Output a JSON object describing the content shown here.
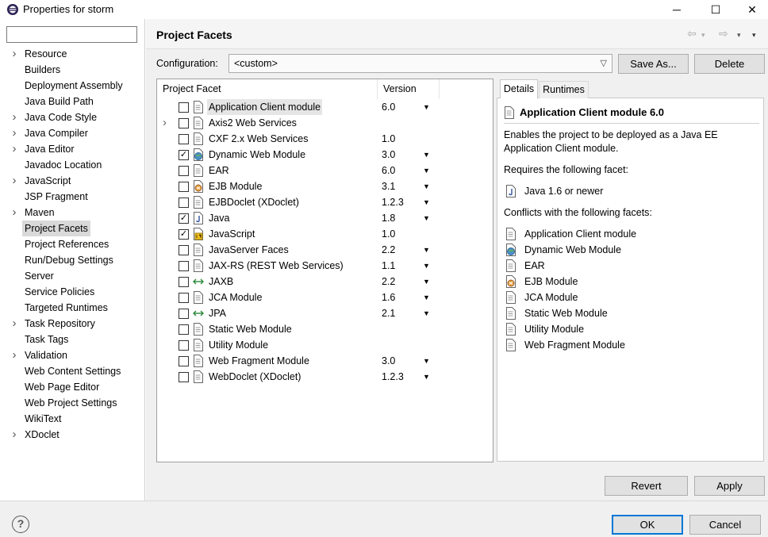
{
  "window": {
    "title": "Properties for storm",
    "minimize": "─",
    "maximize": "☐",
    "close": "✕"
  },
  "sidebar": {
    "filter_value": "",
    "items": [
      {
        "label": "Resource",
        "expandable": true
      },
      {
        "label": "Builders",
        "expandable": false
      },
      {
        "label": "Deployment Assembly",
        "expandable": false
      },
      {
        "label": "Java Build Path",
        "expandable": false
      },
      {
        "label": "Java Code Style",
        "expandable": true
      },
      {
        "label": "Java Compiler",
        "expandable": true
      },
      {
        "label": "Java Editor",
        "expandable": true
      },
      {
        "label": "Javadoc Location",
        "expandable": false
      },
      {
        "label": "JavaScript",
        "expandable": true
      },
      {
        "label": "JSP Fragment",
        "expandable": false
      },
      {
        "label": "Maven",
        "expandable": true
      },
      {
        "label": "Project Facets",
        "expandable": false,
        "selected": true
      },
      {
        "label": "Project References",
        "expandable": false
      },
      {
        "label": "Run/Debug Settings",
        "expandable": false
      },
      {
        "label": "Server",
        "expandable": false
      },
      {
        "label": "Service Policies",
        "expandable": false
      },
      {
        "label": "Targeted Runtimes",
        "expandable": false
      },
      {
        "label": "Task Repository",
        "expandable": true
      },
      {
        "label": "Task Tags",
        "expandable": false
      },
      {
        "label": "Validation",
        "expandable": true
      },
      {
        "label": "Web Content Settings",
        "expandable": false
      },
      {
        "label": "Web Page Editor",
        "expandable": false
      },
      {
        "label": "Web Project Settings",
        "expandable": false
      },
      {
        "label": "WikiText",
        "expandable": false
      },
      {
        "label": "XDoclet",
        "expandable": true
      }
    ]
  },
  "page": {
    "title": "Project Facets",
    "config_label": "Configuration:",
    "config_value": "<custom>",
    "save_as": "Save As...",
    "delete": "Delete",
    "revert": "Revert",
    "apply": "Apply"
  },
  "facets": {
    "col_facet": "Project Facet",
    "col_version": "Version",
    "rows": [
      {
        "name": "Application Client module",
        "version": "6.0",
        "checked": false,
        "dropdown": true,
        "icon": "doc",
        "highlight": true
      },
      {
        "name": "Axis2 Web Services",
        "version": "",
        "checked": false,
        "dropdown": false,
        "icon": "doc",
        "expandable": true
      },
      {
        "name": "CXF 2.x Web Services",
        "version": "1.0",
        "checked": false,
        "dropdown": false,
        "icon": "doc"
      },
      {
        "name": "Dynamic Web Module",
        "version": "3.0",
        "checked": true,
        "dropdown": true,
        "icon": "web"
      },
      {
        "name": "EAR",
        "version": "6.0",
        "checked": false,
        "dropdown": true,
        "icon": "doc"
      },
      {
        "name": "EJB Module",
        "version": "3.1",
        "checked": false,
        "dropdown": true,
        "icon": "ejb"
      },
      {
        "name": "EJBDoclet (XDoclet)",
        "version": "1.2.3",
        "checked": false,
        "dropdown": true,
        "icon": "doc"
      },
      {
        "name": "Java",
        "version": "1.8",
        "checked": true,
        "dropdown": true,
        "icon": "java"
      },
      {
        "name": "JavaScript",
        "version": "1.0",
        "checked": true,
        "dropdown": false,
        "icon": "js"
      },
      {
        "name": "JavaServer Faces",
        "version": "2.2",
        "checked": false,
        "dropdown": true,
        "icon": "doc"
      },
      {
        "name": "JAX-RS (REST Web Services)",
        "version": "1.1",
        "checked": false,
        "dropdown": true,
        "icon": "doc"
      },
      {
        "name": "JAXB",
        "version": "2.2",
        "checked": false,
        "dropdown": true,
        "icon": "arrows"
      },
      {
        "name": "JCA Module",
        "version": "1.6",
        "checked": false,
        "dropdown": true,
        "icon": "doc"
      },
      {
        "name": "JPA",
        "version": "2.1",
        "checked": false,
        "dropdown": true,
        "icon": "arrows"
      },
      {
        "name": "Static Web Module",
        "version": "",
        "checked": false,
        "dropdown": false,
        "icon": "doc"
      },
      {
        "name": "Utility Module",
        "version": "",
        "checked": false,
        "dropdown": false,
        "icon": "doc"
      },
      {
        "name": "Web Fragment Module",
        "version": "3.0",
        "checked": false,
        "dropdown": true,
        "icon": "doc"
      },
      {
        "name": "WebDoclet (XDoclet)",
        "version": "1.2.3",
        "checked": false,
        "dropdown": true,
        "icon": "doc"
      }
    ]
  },
  "details": {
    "tab_details": "Details",
    "tab_runtimes": "Runtimes",
    "title": "Application Client module 6.0",
    "description_1": "Enables the project to be deployed as a Java EE",
    "description_2": "Application Client module.",
    "requires_label": "Requires the following facet:",
    "requires": [
      {
        "name": "Java 1.6 or newer",
        "icon": "java"
      }
    ],
    "conflicts_label": "Conflicts with the following facets:",
    "conflicts": [
      {
        "name": "Application Client module",
        "icon": "doc"
      },
      {
        "name": "Dynamic Web Module",
        "icon": "web"
      },
      {
        "name": "EAR",
        "icon": "doc"
      },
      {
        "name": "EJB Module",
        "icon": "ejb"
      },
      {
        "name": "JCA Module",
        "icon": "doc"
      },
      {
        "name": "Static Web Module",
        "icon": "doc"
      },
      {
        "name": "Utility Module",
        "icon": "doc"
      },
      {
        "name": "Web Fragment Module",
        "icon": "doc"
      }
    ]
  },
  "footer": {
    "help": "?",
    "ok": "OK",
    "cancel": "Cancel"
  },
  "colors": {
    "accent": "#0078d7",
    "selection": "#d9d9d9"
  }
}
